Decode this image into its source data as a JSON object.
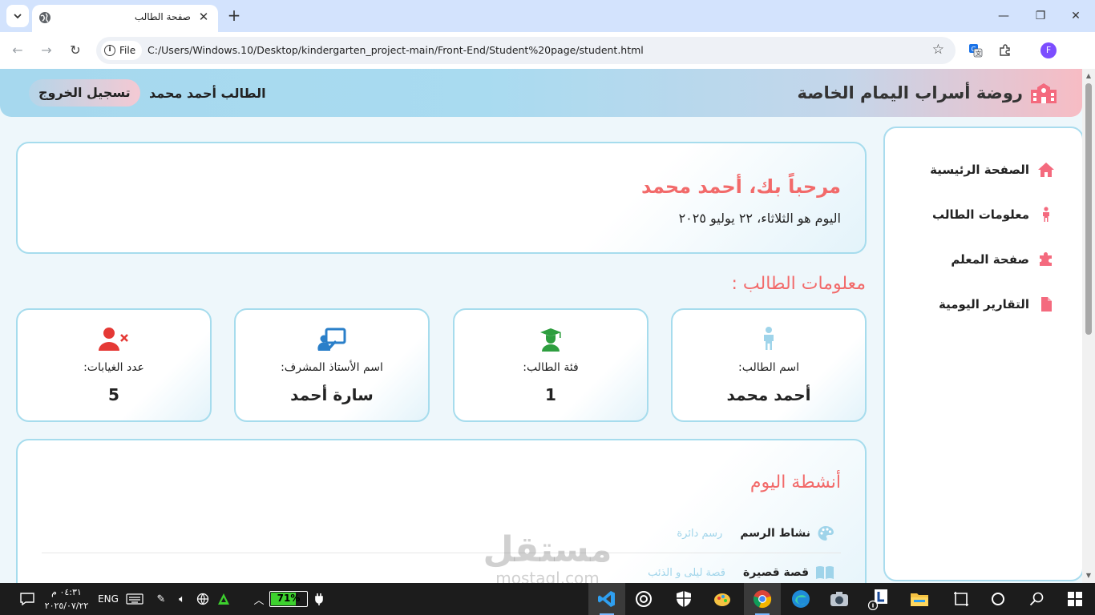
{
  "browser": {
    "tab_title": "صفحة الطالب",
    "chip_label": "File",
    "url": "C:/Users/Windows.10/Desktop/kindergarten_project-main/Front-End/Student%20page/student.html",
    "profile_initial": "F"
  },
  "header": {
    "brand_name": "روضة أسراب اليمام الخاصة",
    "student_label": "الطالب أحمد محمد",
    "logout_label": "تسجيل الخروج"
  },
  "sidebar": {
    "items": [
      {
        "label": "الصفحة الرئيسية",
        "icon": "home-icon"
      },
      {
        "label": "معلومات الطالب",
        "icon": "child-icon"
      },
      {
        "label": "صفحة المعلم",
        "icon": "puzzle-icon"
      },
      {
        "label": "التقارير اليومية",
        "icon": "file-icon"
      }
    ]
  },
  "welcome": {
    "title": "مرحباً بك، أحمد محمد",
    "date": "اليوم هو الثلاثاء، ٢٢ يوليو ٢٠٢٥"
  },
  "student_info": {
    "title": "معلومات الطالب :",
    "cards": [
      {
        "label": "اسم الطالب:",
        "value": "أحمد محمد",
        "icon": "child-icon"
      },
      {
        "label": "فئة الطالب:",
        "value": "1",
        "icon": "graduate-icon"
      },
      {
        "label": "اسم الأستاذ المشرف:",
        "value": "سارة أحمد",
        "icon": "teacher-icon"
      },
      {
        "label": "عدد الغيابات:",
        "value": "5",
        "icon": "user-absent-icon"
      }
    ]
  },
  "activities": {
    "title": "أنشطة اليوم",
    "items": [
      {
        "name": "نشاط الرسم",
        "desc": "رسم دائرة",
        "icon": "palette-icon"
      },
      {
        "name": "قصة قصيرة",
        "desc": "قصة ليلى و الذئب",
        "icon": "book-icon"
      }
    ]
  },
  "watermark": {
    "big": "مستقل",
    "small": "mostaql.com"
  },
  "taskbar": {
    "clock_time": "٠٤:٣١ م",
    "clock_date": "٢٠٢٥/٠٧/٢٢",
    "language": "ENG",
    "battery_percent": 71,
    "battery_label": "71%"
  },
  "colors": {
    "accent_title": "#f26a6a",
    "border": "#a6dced",
    "icon_blue": "#9fd4ea",
    "icon_green": "#2e9e3f",
    "icon_red": "#e53935",
    "icon_pink": "#f46a7e"
  }
}
